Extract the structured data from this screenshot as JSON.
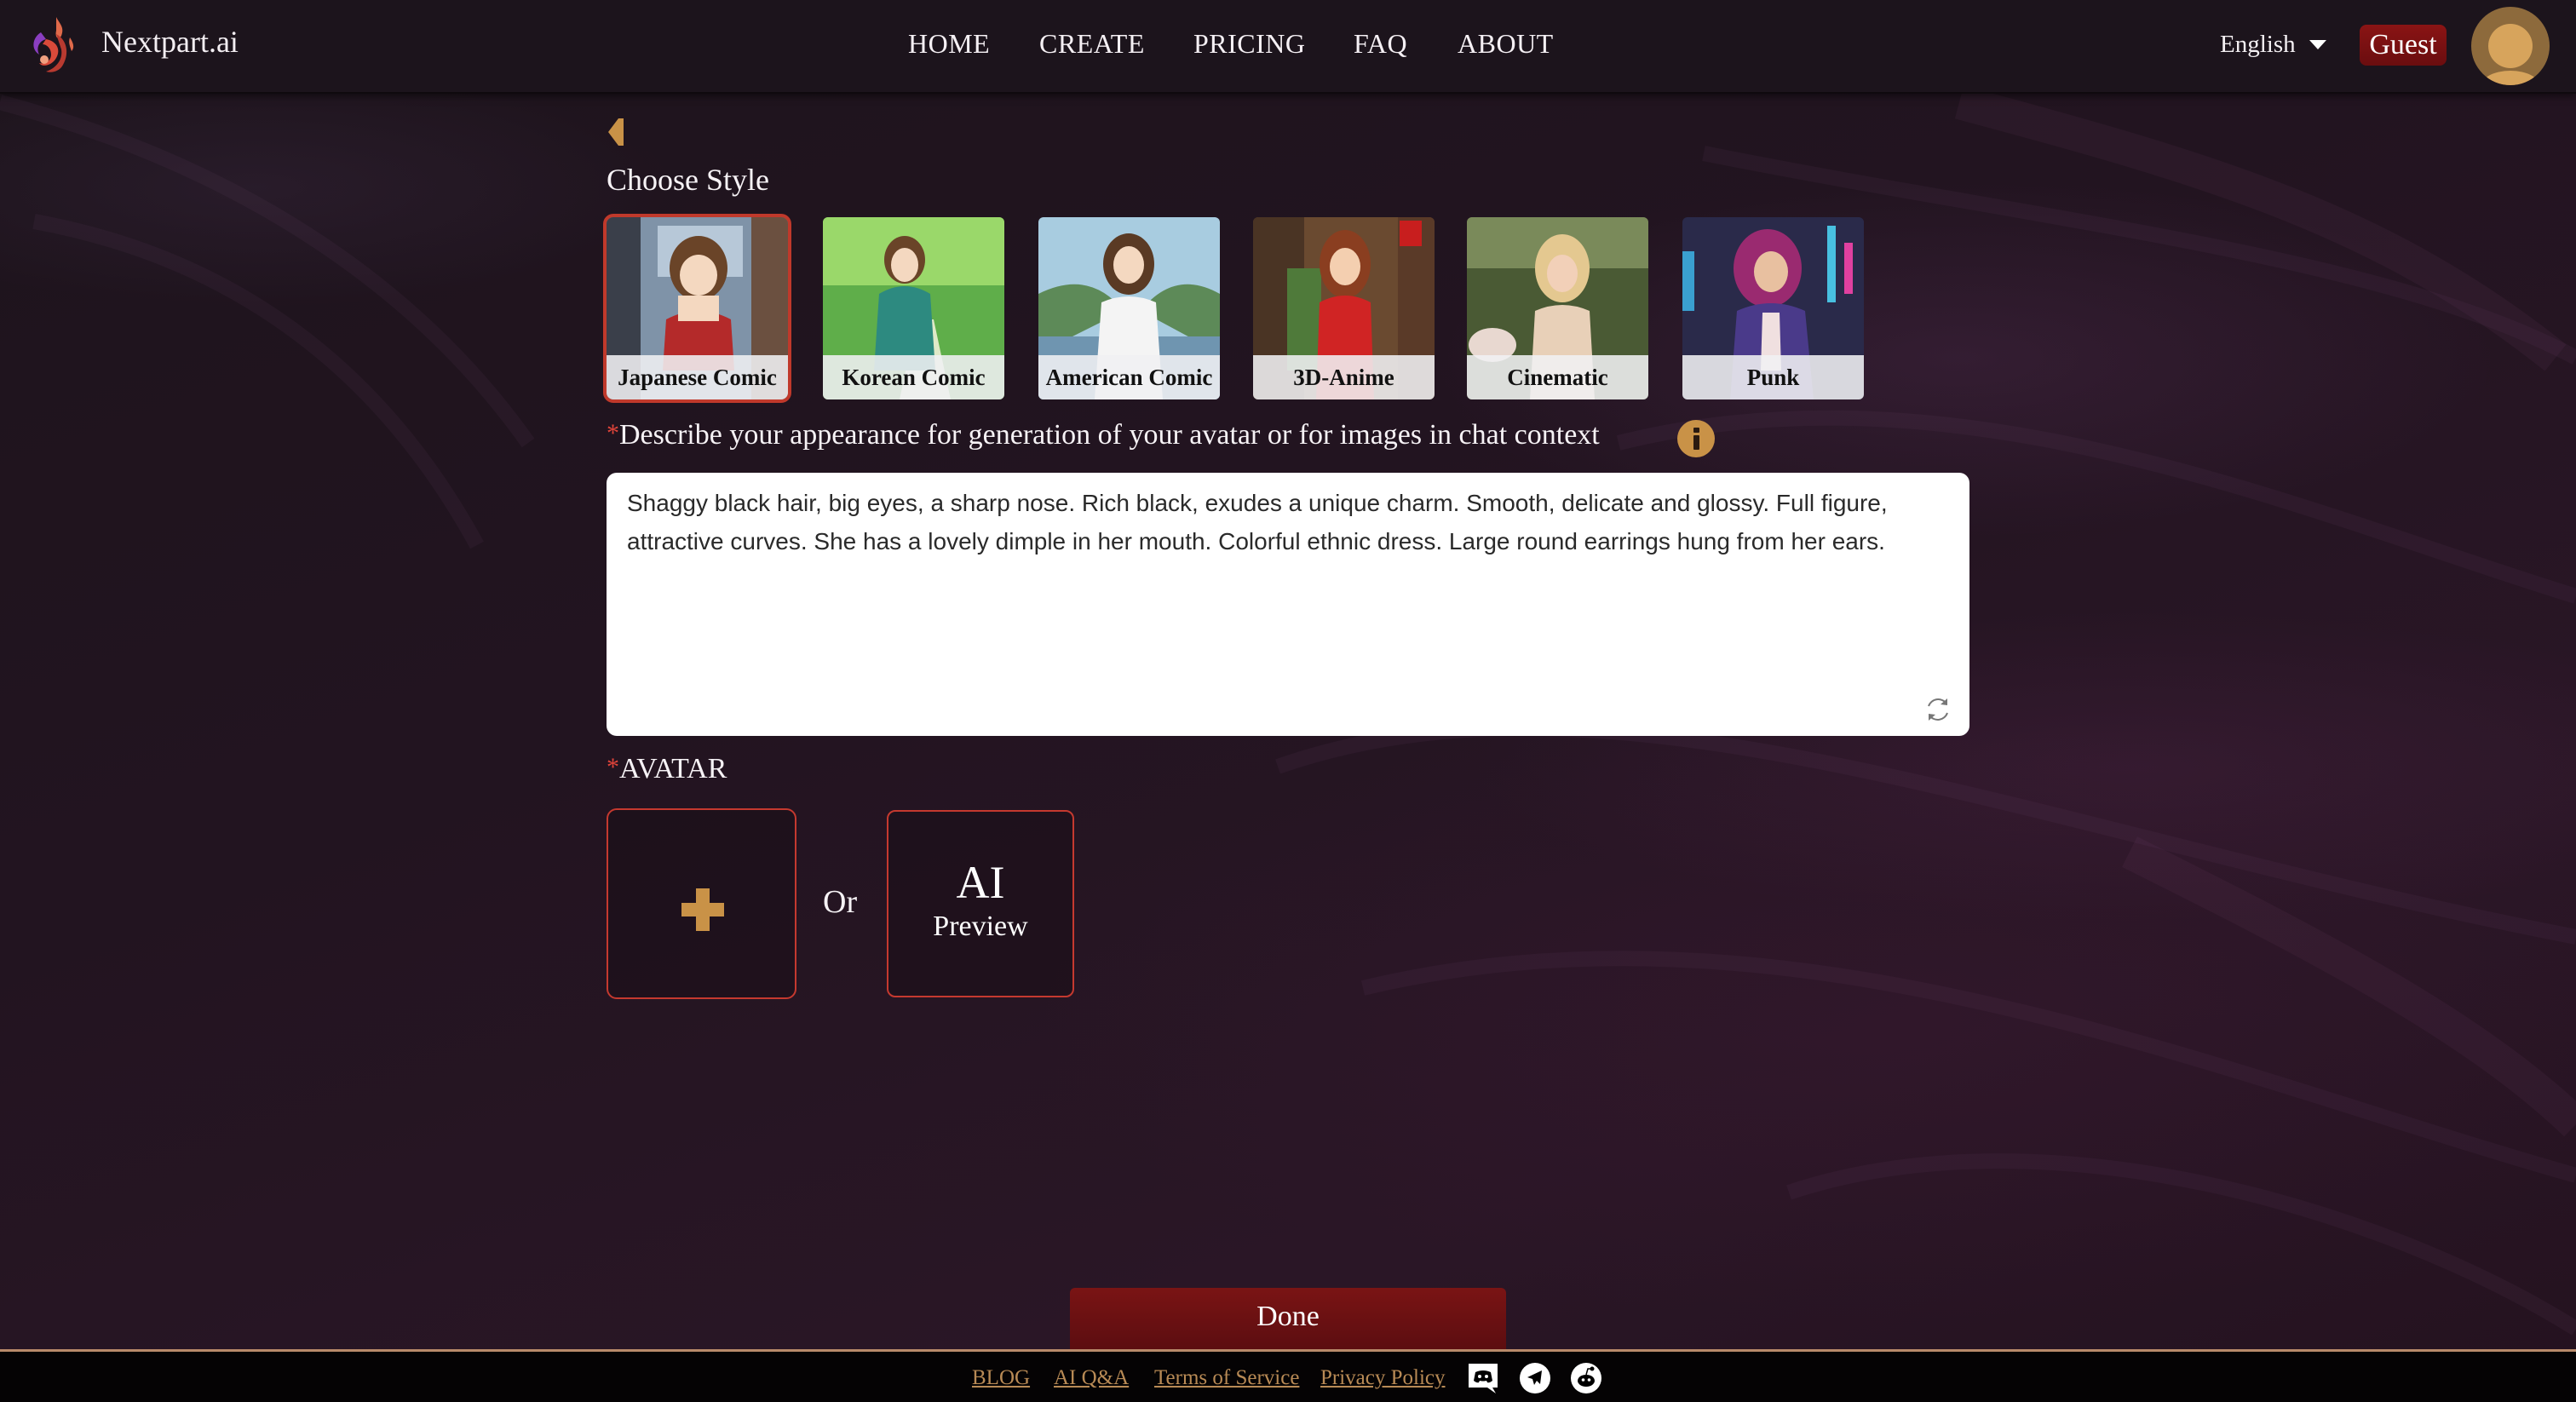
{
  "header": {
    "brand": "Nextpart.ai",
    "nav": [
      {
        "label": "HOME"
      },
      {
        "label": "CREATE"
      },
      {
        "label": "PRICING"
      },
      {
        "label": "FAQ"
      },
      {
        "label": "ABOUT"
      }
    ],
    "language": "English",
    "guest_label": "Guest"
  },
  "main": {
    "section_title": "Choose Style",
    "styles": [
      {
        "label": "Japanese Comic",
        "selected": true
      },
      {
        "label": "Korean Comic",
        "selected": false
      },
      {
        "label": "American Comic",
        "selected": false
      },
      {
        "label": "3D-Anime",
        "selected": false
      },
      {
        "label": "Cinematic",
        "selected": false
      },
      {
        "label": "Punk",
        "selected": false
      }
    ],
    "description": {
      "required_mark": "*",
      "label": "Describe your appearance for generation of your avatar or for images in chat context",
      "value": "Shaggy black hair, big eyes, a sharp nose. Rich black, exudes a unique charm. Smooth, delicate and glossy. Full figure, attractive curves. She has a lovely dimple in her mouth. Colorful ethnic dress. Large round earrings hung from her ears."
    },
    "avatar": {
      "required_mark": "*",
      "label": "AVATAR",
      "or_text": "Or",
      "ai_label": "AI",
      "preview_label": "Preview"
    },
    "done_label": "Done"
  },
  "footer": {
    "links": [
      {
        "label": "BLOG"
      },
      {
        "label": "AI Q&A"
      },
      {
        "label": "Terms of Service"
      },
      {
        "label": "Privacy Policy"
      }
    ],
    "social": [
      "discord-icon",
      "telegram-icon",
      "reddit-icon"
    ]
  },
  "colors": {
    "accent_gold": "#c99247",
    "accent_red": "#c5392f",
    "button_red": "#7a1414",
    "background": "#1c1219"
  }
}
